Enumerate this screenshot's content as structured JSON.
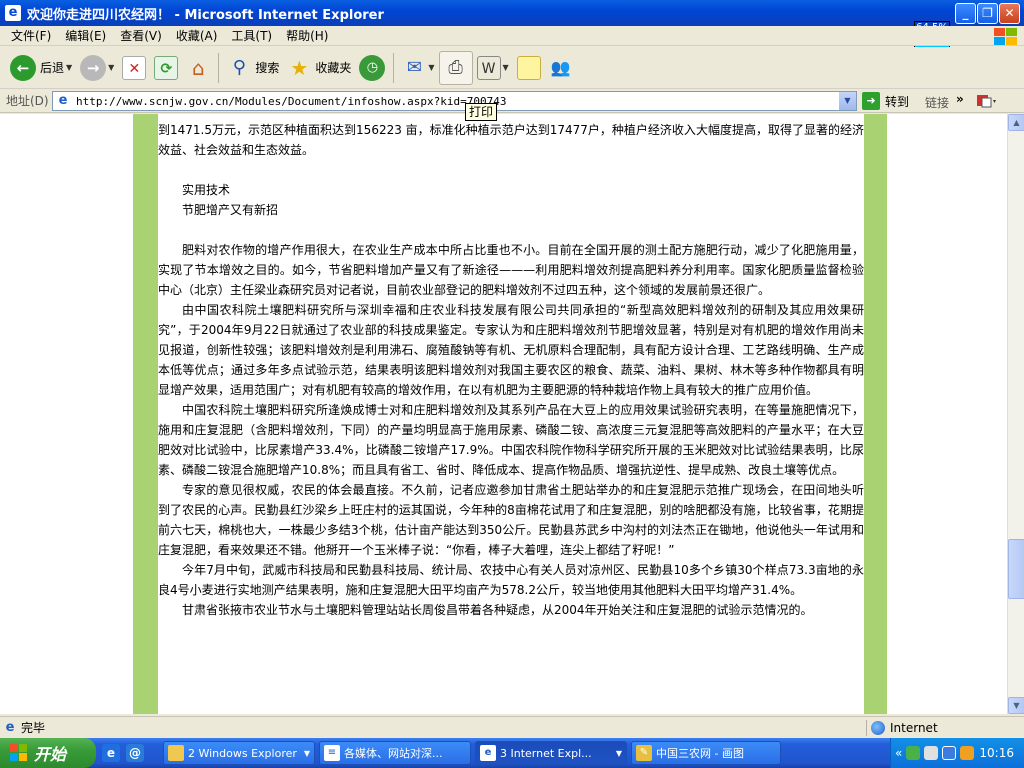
{
  "window": {
    "title": "欢迎你走进四川农经网！ - Microsoft Internet Explorer",
    "overlay_percent": "64.5%"
  },
  "menu": [
    "文件(F)",
    "编辑(E)",
    "查看(V)",
    "收藏(A)",
    "工具(T)",
    "帮助(H)"
  ],
  "toolbar": {
    "back": "后退",
    "search": "搜索",
    "favorites": "收藏夹"
  },
  "address": {
    "label": "地址(D)",
    "url": "http://www.scnjw.gov.cn/Modules/Document/infoshow.aspx?kid=700743",
    "go": "转到",
    "links": "链接"
  },
  "tooltip": "打印",
  "article": {
    "p0": "到1471.5万元，示范区种植面积达到156223 亩，标准化种植示范户达到17477户，种植户经济收入大幅度提高，取得了显著的经济效益、社会效益和生态效益。",
    "section": "实用技术",
    "headline": "节肥增产又有新招",
    "p1": "肥料对农作物的增产作用很大，在农业生产成本中所占比重也不小。目前在全国开展的测土配方施肥行动，减少了化肥施用量，实现了节本增效之目的。如今，节省肥料增加产量又有了新途径———利用肥料增效剂提高肥料养分利用率。国家化肥质量监督检验中心（北京）主任梁业森研究员对记者说，目前农业部登记的肥料增效剂不过四五种，这个领域的发展前景还很广。",
    "p2": "由中国农科院土壤肥料研究所与深圳幸福和庄农业科技发展有限公司共同承担的“新型高效肥料增效剂的研制及其应用效果研究”，于2004年9月22日就通过了农业部的科技成果鉴定。专家认为和庄肥料增效剂节肥增效显著，特别是对有机肥的增效作用尚未见报道，创新性较强；该肥料增效剂是利用沸石、腐殖酸钠等有机、无机原料合理配制，具有配方设计合理、工艺路线明确、生产成本低等优点；通过多年多点试验示范，结果表明该肥料增效剂对我国主要农区的粮食、蔬菜、油料、果树、林木等多种作物都具有明显增产效果，适用范围广；对有机肥有较高的增效作用，在以有机肥为主要肥源的特种栽培作物上具有较大的推广应用价值。",
    "p3": "中国农科院土壤肥料研究所逢焕成博士对和庄肥料增效剂及其系列产品在大豆上的应用效果试验研究表明，在等量施肥情况下，施用和庄复混肥（含肥料增效剂，下同）的产量均明显高于施用尿素、磷酸二铵、高浓度三元复混肥等高效肥料的产量水平；在大豆肥效对比试验中，比尿素增产33.4%，比磷酸二铵增产17.9%。中国农科院作物科学研究所开展的玉米肥效对比试验结果表明，比尿素、磷酸二铵混合施肥增产10.8%；而且具有省工、省时、降低成本、提高作物品质、增强抗逆性、提早成熟、改良土壤等优点。",
    "p4": "专家的意见很权威，农民的体会最直接。不久前，记者应邀参加甘肃省土肥站举办的和庄复混肥示范推广现场会，在田间地头听到了农民的心声。民勤县红沙梁乡上旺庄村的运其国说，今年种的8亩棉花试用了和庄复混肥，别的啥肥都没有施，比较省事，花期提前六七天，棉桃也大，一株最少多结3个桃，估计亩产能达到350公斤。民勤县苏武乡中沟村的刘法杰正在锄地，他说他头一年试用和庄复混肥，看来效果还不错。他掰开一个玉米棒子说：“你看，棒子大着哩，连尖上都结了籽呢！”",
    "p5": "今年7月中旬，武威市科技局和民勤县科技局、统计局、农技中心有关人员对凉州区、民勤县10多个乡镇30个样点73.3亩地的永良4号小麦进行实地测产结果表明，施和庄复混肥大田平均亩产为578.2公斤，较当地使用其他肥料大田平均增产31.4%。",
    "p6": "甘肃省张掖市农业节水与土壤肥料管理站站长周俊昌带着各种疑虑，从2004年开始关注和庄复混肥的试验示范情况的。"
  },
  "status": {
    "text": "完毕",
    "zone": "Internet"
  },
  "taskbar": {
    "start": "开始",
    "tasks": [
      "2 Windows Explorer",
      "各媒体、网站对深...",
      "3 Internet Expl...",
      "中国三农网 - 画图"
    ],
    "clock": "10:16"
  }
}
